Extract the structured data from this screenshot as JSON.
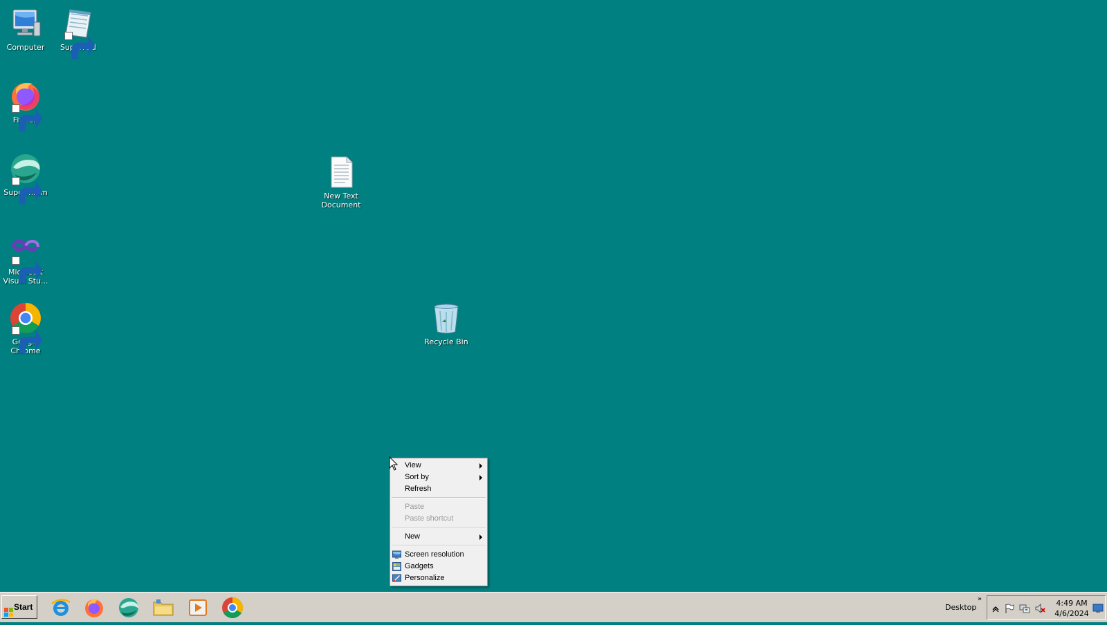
{
  "desktop": {
    "background_color": "#008080",
    "icons": [
      {
        "label": "Computer",
        "icon": "computer-icon"
      },
      {
        "label": "SuperPad",
        "icon": "notepad-icon"
      },
      {
        "label": "Firefox",
        "icon": "firefox-icon"
      },
      {
        "label": "Supermium",
        "icon": "supermium-icon"
      },
      {
        "label": "Microsoft Visual Stu...",
        "icon": "visual-studio-icon"
      },
      {
        "label": "Google Chrome",
        "icon": "chrome-icon"
      },
      {
        "label": "New Text Document",
        "icon": "text-document-icon"
      },
      {
        "label": "Recycle Bin",
        "icon": "recycle-bin-icon"
      }
    ]
  },
  "context_menu": {
    "items": [
      {
        "label": "View",
        "submenu": true,
        "enabled": true
      },
      {
        "label": "Sort by",
        "submenu": true,
        "enabled": true
      },
      {
        "label": "Refresh",
        "enabled": true
      },
      {
        "label": "Paste",
        "enabled": false
      },
      {
        "label": "Paste shortcut",
        "enabled": false
      },
      {
        "label": "New",
        "submenu": true,
        "enabled": true
      },
      {
        "label": "Screen resolution",
        "icon": "screen-resolution-icon",
        "enabled": true
      },
      {
        "label": "Gadgets",
        "icon": "gadgets-icon",
        "enabled": true
      },
      {
        "label": "Personalize",
        "icon": "personalize-icon",
        "enabled": true
      }
    ]
  },
  "taskbar": {
    "start_label": "Start",
    "pinned": [
      "internet-explorer-icon",
      "firefox-icon",
      "supermium-icon",
      "file-explorer-icon",
      "media-player-icon",
      "chrome-icon"
    ],
    "toolbar_label": "Desktop",
    "toolbar_chevron": "»",
    "clock": {
      "time": "4:49 AM",
      "date": "4/6/2024"
    }
  }
}
